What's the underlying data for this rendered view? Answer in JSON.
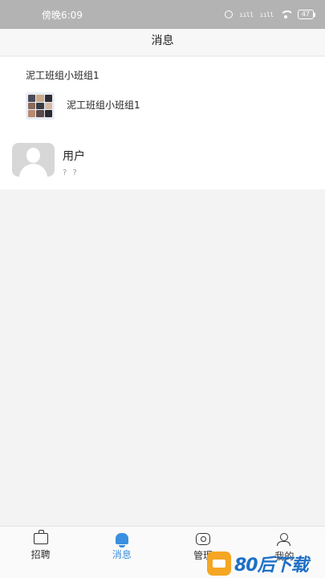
{
  "status_bar": {
    "time": "傍晚6:09",
    "signal1": "ııll",
    "signal2": "ııll",
    "battery": "47"
  },
  "header": {
    "title": "消息"
  },
  "group": {
    "title": "泥工班组小班组1",
    "name": "泥工班组小班组1"
  },
  "user": {
    "name": "用户",
    "subtitle": "? ?"
  },
  "tabs": [
    {
      "label": "招聘",
      "icon": "briefcase-icon"
    },
    {
      "label": "消息",
      "icon": "bell-icon",
      "active": true
    },
    {
      "label": "管理",
      "icon": "manage-icon"
    },
    {
      "label": "我的",
      "icon": "profile-icon"
    }
  ],
  "watermark": {
    "text": "80后下载"
  },
  "colors": {
    "accent": "#3a8fe0",
    "status_bar": "#b3b3b3"
  }
}
